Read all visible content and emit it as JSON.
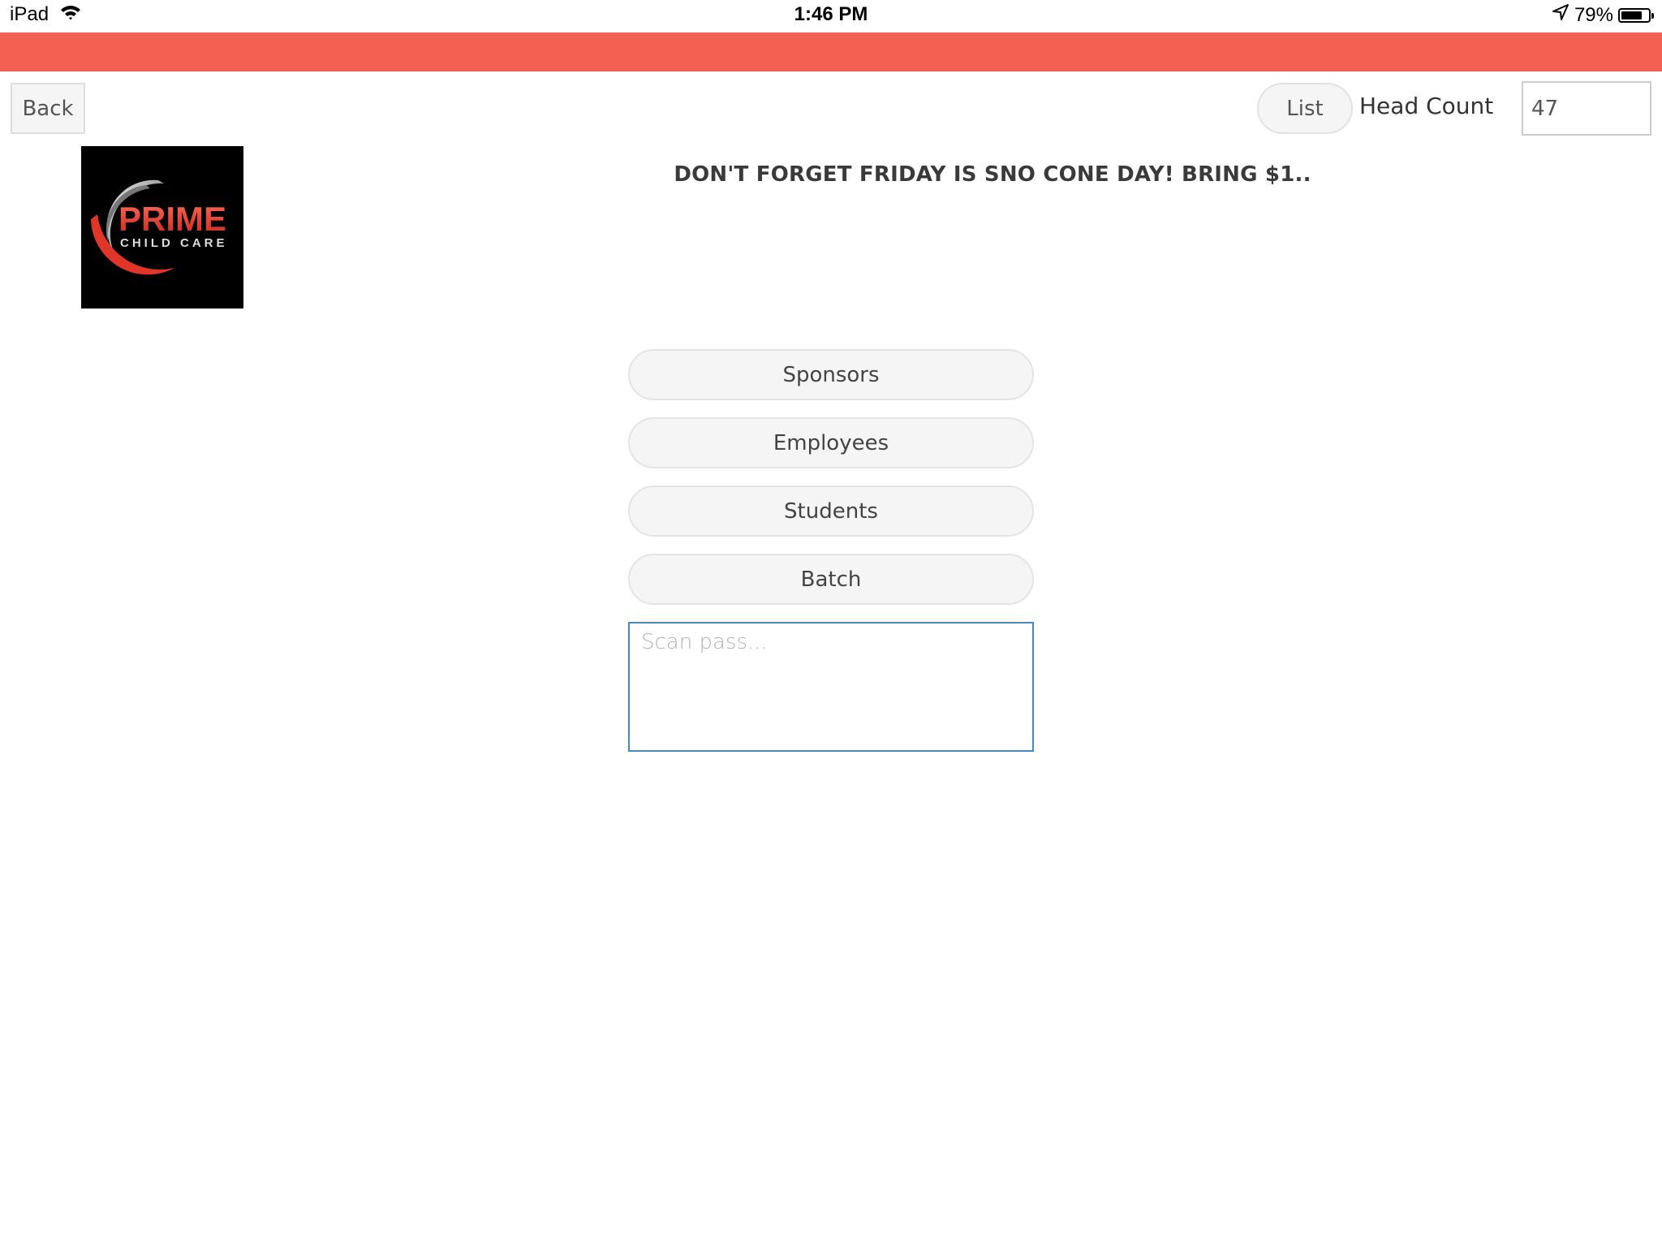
{
  "status_bar": {
    "device": "iPad",
    "time": "1:46 PM",
    "battery_percent_label": "79%",
    "battery_level": 0.79,
    "icons": [
      "wifi-icon",
      "location-arrow-icon",
      "battery-icon"
    ]
  },
  "header": {
    "accent_color": "#f46152",
    "back_label": "Back",
    "list_label": "List",
    "head_count_label": "Head Count",
    "head_count_value": "47"
  },
  "logo": {
    "brand": "PRIME",
    "tagline": "CHILD CARE"
  },
  "banner": {
    "message": "DON'T FORGET FRIDAY IS SNO CONE DAY! BRING $1.."
  },
  "menu": {
    "buttons": [
      {
        "label": "Sponsors"
      },
      {
        "label": "Employees"
      },
      {
        "label": "Students"
      },
      {
        "label": "Batch"
      }
    ]
  },
  "scan": {
    "placeholder": "Scan pass...",
    "value": ""
  }
}
